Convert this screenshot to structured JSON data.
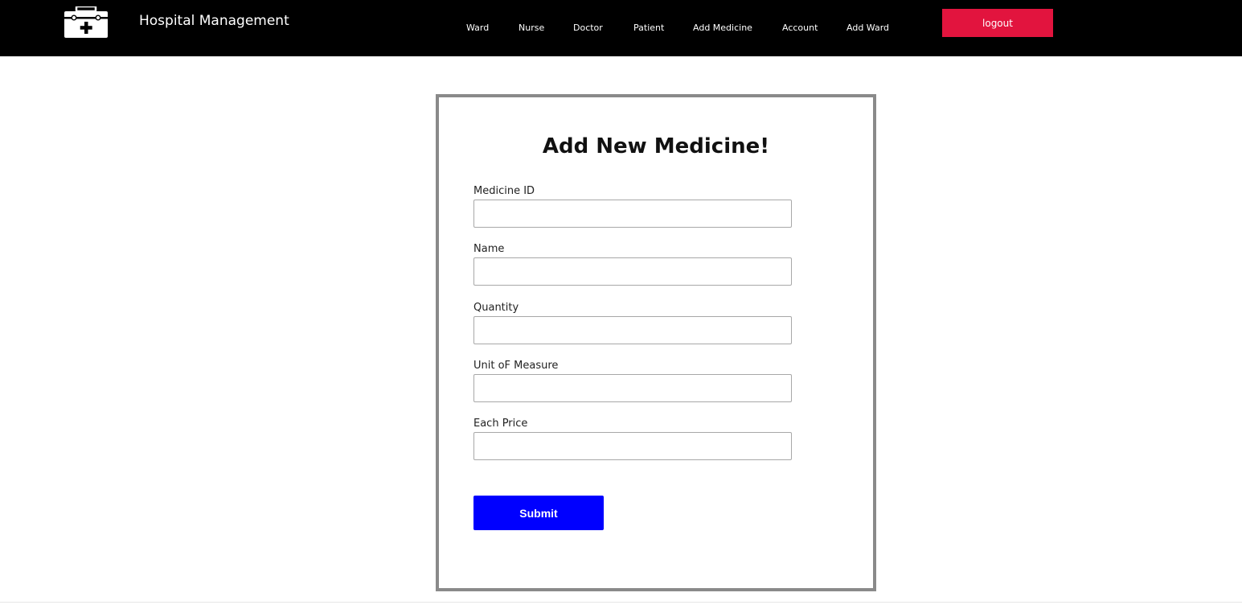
{
  "colors": {
    "navbar_bg": "#000000",
    "logout_bg": "#e2143e",
    "submit_bg": "#0000ff",
    "card_border": "#8a8a8a"
  },
  "header": {
    "logo_icon": "medical-kit-icon",
    "brand": "Hospital Management",
    "nav": [
      {
        "label": "Ward"
      },
      {
        "label": "Nurse"
      },
      {
        "label": "Doctor"
      },
      {
        "label": "Patient"
      },
      {
        "label": "Add Medicine"
      },
      {
        "label": "Account"
      },
      {
        "label": "Add Ward"
      }
    ],
    "logout_label": "logout"
  },
  "form": {
    "title": "Add New Medicine!",
    "fields": [
      {
        "label": "Medicine ID",
        "value": "",
        "placeholder": ""
      },
      {
        "label": "Name",
        "value": "",
        "placeholder": ""
      },
      {
        "label": "Quantity",
        "value": "",
        "placeholder": ""
      },
      {
        "label": "Unit oF Measure",
        "value": "",
        "placeholder": ""
      },
      {
        "label": "Each Price",
        "value": "",
        "placeholder": ""
      }
    ],
    "submit_label": "Submit"
  }
}
